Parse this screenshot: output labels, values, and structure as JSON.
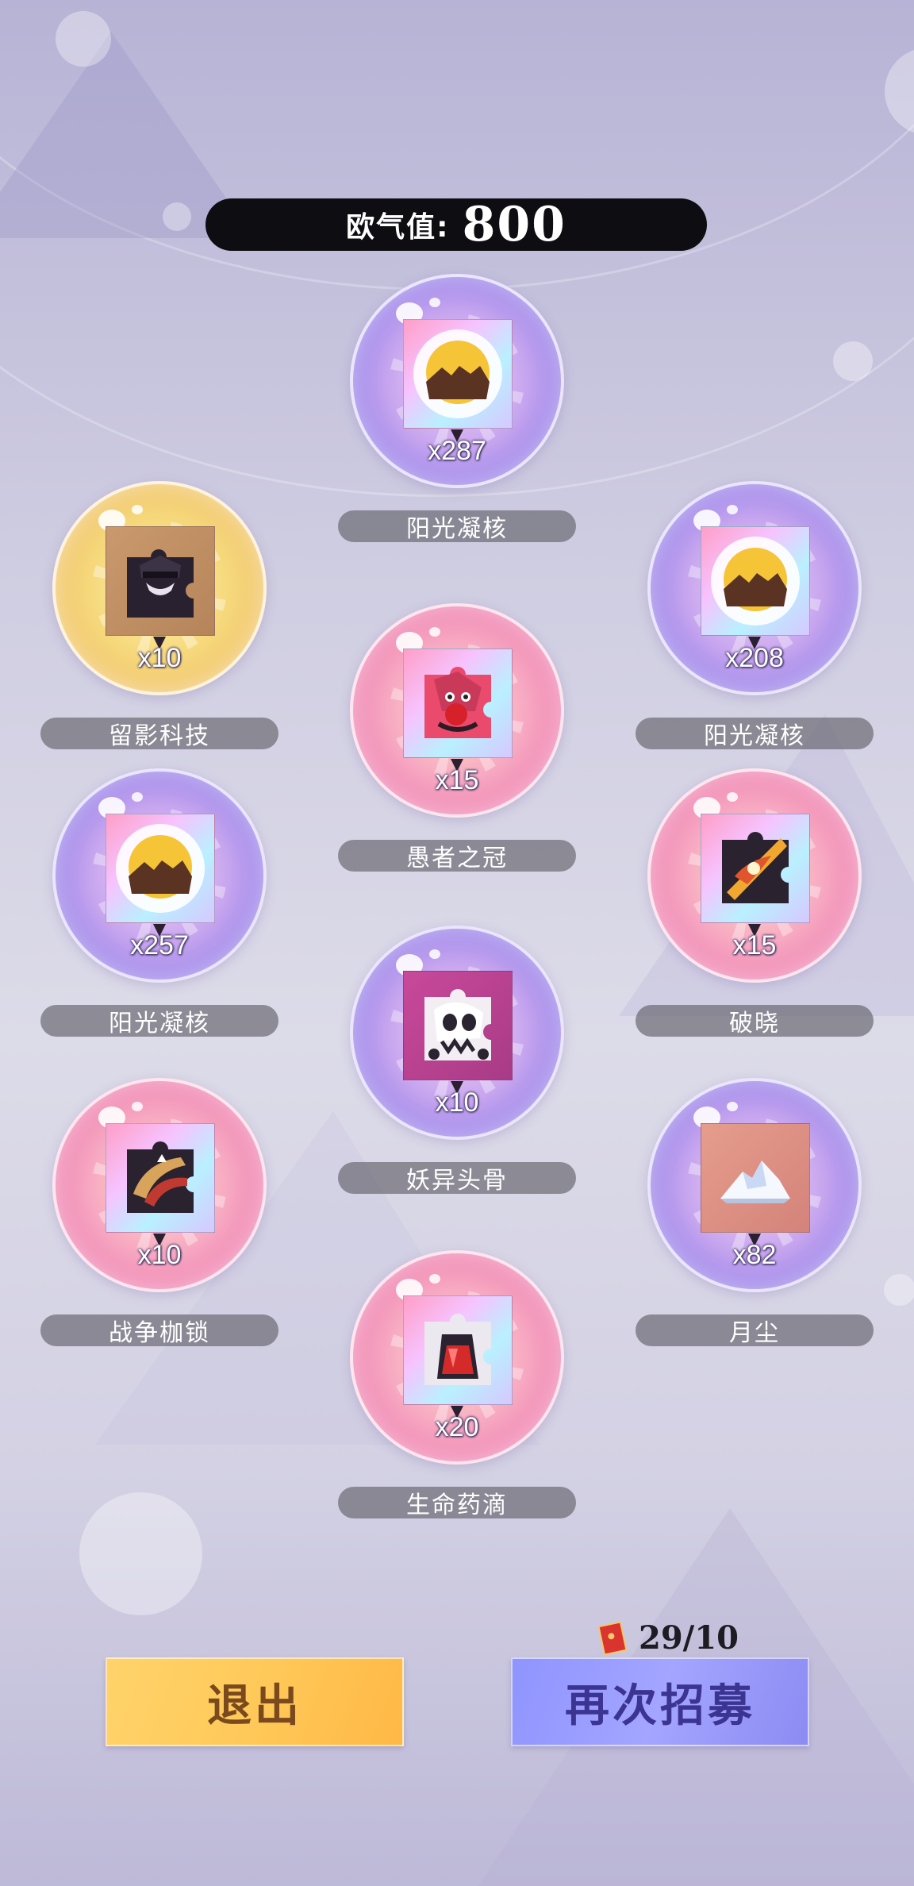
{
  "score": {
    "label": "欧气值:",
    "value": "800"
  },
  "rewards": [
    {
      "name": "阳光凝核",
      "qty": "x287",
      "icon": "sun-core-icon",
      "bubble": "purple"
    },
    {
      "name": "留影科技",
      "qty": "x10",
      "icon": "shadow-tech-puzzle-icon",
      "bubble": "gold"
    },
    {
      "name": "阳光凝核",
      "qty": "x208",
      "icon": "sun-core-icon",
      "bubble": "purple"
    },
    {
      "name": "愚者之冠",
      "qty": "x15",
      "icon": "fools-crown-puzzle-icon",
      "bubble": "pink"
    },
    {
      "name": "阳光凝核",
      "qty": "x257",
      "icon": "sun-core-icon",
      "bubble": "purple"
    },
    {
      "name": "破晓",
      "qty": "x15",
      "icon": "dawn-puzzle-icon",
      "bubble": "pink"
    },
    {
      "name": "妖异头骨",
      "qty": "x10",
      "icon": "demon-skull-puzzle-icon",
      "bubble": "purple"
    },
    {
      "name": "战争枷锁",
      "qty": "x10",
      "icon": "war-shackle-puzzle-icon",
      "bubble": "pink"
    },
    {
      "name": "月尘",
      "qty": "x82",
      "icon": "moon-dust-icon",
      "bubble": "purple"
    },
    {
      "name": "生命药滴",
      "qty": "x20",
      "icon": "life-potion-puzzle-icon",
      "bubble": "pink"
    }
  ],
  "ticket": {
    "icon": "recruit-ticket-icon",
    "count": "29/10"
  },
  "buttons": {
    "exit": "退出",
    "again": "再次招募"
  },
  "colors": {
    "exit_button": "#ffc959",
    "again_button": "#a3a5ff",
    "score_bar": "#0d0d12"
  }
}
